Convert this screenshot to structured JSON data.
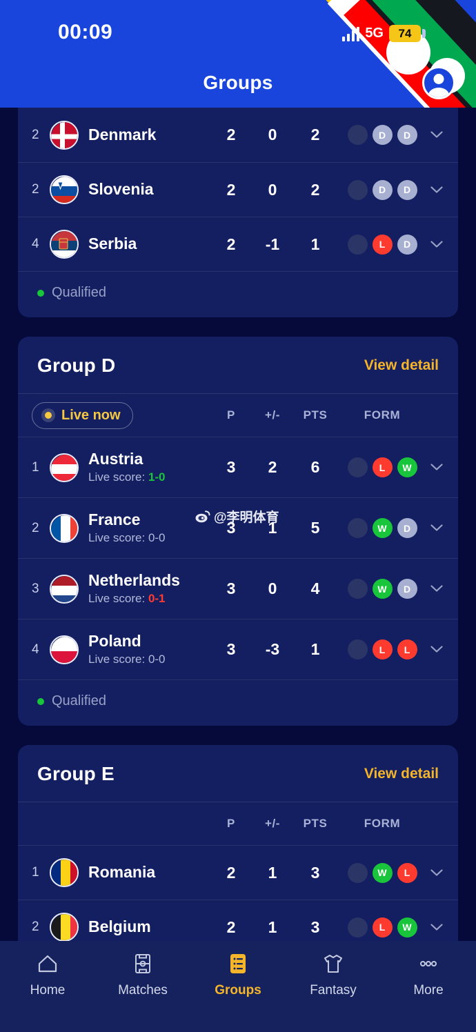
{
  "status_bar": {
    "time": "00:09",
    "network": "5G",
    "battery": "74",
    "signal_icon": "signal-bars-icon",
    "avatar_icon": "user-avatar-icon"
  },
  "header": {
    "title": "Groups"
  },
  "columns": {
    "p": "P",
    "gd": "+/-",
    "pts": "PTS",
    "form": "FORM"
  },
  "legend": {
    "qualified": "Qualified"
  },
  "watermark": {
    "icon": "weibo-icon",
    "text": "@李明体育"
  },
  "groups": [
    {
      "name": "",
      "view_detail": "",
      "partial": true,
      "live_badge": null,
      "rows": [
        {
          "rank": "2",
          "team": "Denmark",
          "flag": "denmark-flag",
          "live_score_label": null,
          "live_score_value": null,
          "live_score_state": null,
          "p": "2",
          "gd": "0",
          "pts": "2",
          "form": [
            "empty",
            "D",
            "D"
          ],
          "qualified_bar": false
        },
        {
          "rank": "2",
          "team": "Slovenia",
          "flag": "slovenia-flag",
          "live_score_label": null,
          "live_score_value": null,
          "live_score_state": null,
          "p": "2",
          "gd": "0",
          "pts": "2",
          "form": [
            "empty",
            "D",
            "D"
          ],
          "qualified_bar": false
        },
        {
          "rank": "4",
          "team": "Serbia",
          "flag": "serbia-flag",
          "live_score_label": null,
          "live_score_value": null,
          "live_score_state": null,
          "p": "2",
          "gd": "-1",
          "pts": "1",
          "form": [
            "empty",
            "L",
            "D"
          ],
          "qualified_bar": false
        }
      ],
      "legend_text": "Qualified"
    },
    {
      "name": "Group D",
      "view_detail": "View detail",
      "partial": false,
      "live_badge": "Live now",
      "rows": [
        {
          "rank": "1",
          "team": "Austria",
          "flag": "austria-flag",
          "live_score_label": "Live score: ",
          "live_score_value": "1-0",
          "live_score_state": "green",
          "p": "3",
          "gd": "2",
          "pts": "6",
          "form": [
            "empty",
            "L",
            "W"
          ],
          "qualified_bar": false
        },
        {
          "rank": "2",
          "team": "France",
          "flag": "france-flag",
          "live_score_label": "Live score: ",
          "live_score_value": "0-0",
          "live_score_state": "plain",
          "p": "3",
          "gd": "1",
          "pts": "5",
          "form": [
            "empty",
            "W",
            "D"
          ],
          "qualified_bar": true
        },
        {
          "rank": "3",
          "team": "Netherlands",
          "flag": "netherlands-flag",
          "live_score_label": "Live score: ",
          "live_score_value": "0-1",
          "live_score_state": "red",
          "p": "3",
          "gd": "0",
          "pts": "4",
          "form": [
            "empty",
            "W",
            "D"
          ],
          "qualified_bar": true
        },
        {
          "rank": "4",
          "team": "Poland",
          "flag": "poland-flag",
          "live_score_label": "Live score: ",
          "live_score_value": "0-0",
          "live_score_state": "plain",
          "p": "3",
          "gd": "-3",
          "pts": "1",
          "form": [
            "empty",
            "L",
            "L"
          ],
          "qualified_bar": false
        }
      ],
      "legend_text": "Qualified"
    },
    {
      "name": "Group E",
      "view_detail": "View detail",
      "partial": false,
      "live_badge": null,
      "rows": [
        {
          "rank": "1",
          "team": "Romania",
          "flag": "romania-flag",
          "live_score_label": null,
          "live_score_value": null,
          "live_score_state": null,
          "p": "2",
          "gd": "1",
          "pts": "3",
          "form": [
            "empty",
            "W",
            "L"
          ],
          "qualified_bar": false
        },
        {
          "rank": "2",
          "team": "Belgium",
          "flag": "belgium-flag",
          "live_score_label": null,
          "live_score_value": null,
          "live_score_state": null,
          "p": "2",
          "gd": "1",
          "pts": "3",
          "form": [
            "empty",
            "L",
            "W"
          ],
          "qualified_bar": false
        }
      ],
      "legend_text": null
    }
  ],
  "bottom_nav": [
    {
      "label": "Home",
      "icon": "home-icon",
      "active": false
    },
    {
      "label": "Matches",
      "icon": "pitch-icon",
      "active": false
    },
    {
      "label": "Groups",
      "icon": "list-icon",
      "active": true
    },
    {
      "label": "Fantasy",
      "icon": "shirt-icon",
      "active": false
    },
    {
      "label": "More",
      "icon": "ellipsis-icon",
      "active": false
    }
  ],
  "colors": {
    "header_blue": "#1a45dd",
    "page_bg": "#050a3a",
    "card_bg": "#141f62",
    "accent_gold": "#f5b52a",
    "win_green": "#19c53a",
    "loss_red": "#ff3b30",
    "draw_grey": "#a8b0d2",
    "qualified_green": "#0f9d2f"
  }
}
